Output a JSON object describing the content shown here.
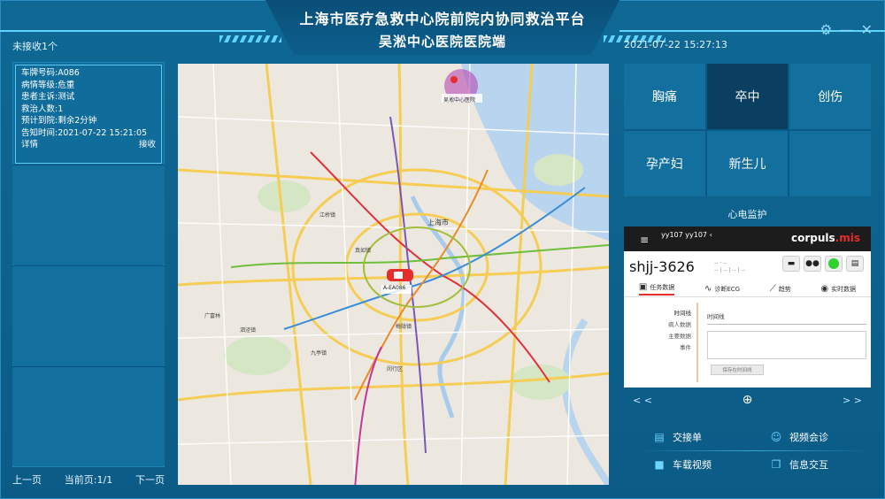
{
  "header": {
    "title_line1": "上海市医疗急救中心院前院内协同救治平台",
    "title_line2": "吴淞中心医院医院端",
    "unreceived": "未接收1个",
    "datetime": "2021-07-22 15:27:13"
  },
  "window_controls": {
    "settings_icon": "gear-icon",
    "minimize": "—",
    "close": "✕"
  },
  "patient_card": {
    "plate": "车牌号码:A086",
    "severity": "病情等级:危重",
    "complaint": "患者主诉:测试",
    "rescue_count": "救治人数:1",
    "eta": "预计到院:剩余2分钟",
    "notify_time": "告知时间:2021-07-22 15:21:05",
    "detail_label": "详情",
    "receive_label": "接收"
  },
  "pager": {
    "prev": "上一页",
    "current": "当前页:1/1",
    "next": "下一页"
  },
  "map": {
    "hospital_label": "吴淞中心医院",
    "vehicle_label": "A-EA086",
    "district_labels": [
      "上海市",
      "九亭镇",
      "泗泾镇",
      "广富林",
      "江桥镇",
      "真如镇",
      "梅陇镇",
      "闵行区"
    ]
  },
  "categories": [
    {
      "label": "胸痛",
      "active": false
    },
    {
      "label": "卒中",
      "active": true
    },
    {
      "label": "创伤",
      "active": false
    },
    {
      "label": "孕产妇",
      "active": false
    },
    {
      "label": "新生儿",
      "active": false
    }
  ],
  "ecg": {
    "section_title": "心电监护",
    "device_name": "yy107 yy107 ‹",
    "brand_main": "corpuls",
    "brand_suffix": ".mis",
    "device_id": "shjj-3626",
    "tabs": [
      "任务数据",
      "诊断ECG",
      "趋势",
      "实时数据"
    ],
    "side_items": [
      "时间线",
      "病人数据",
      "主要数据",
      "事件"
    ],
    "form_label": "时间线",
    "save_label": "保存在时间线",
    "nav_prev": "< <",
    "nav_next": "> >"
  },
  "actions": [
    {
      "label": "交接单",
      "icon": "document-icon"
    },
    {
      "label": "视频会诊",
      "icon": "group-icon"
    },
    {
      "label": "车载视频",
      "icon": "camera-icon"
    },
    {
      "label": "信息交互",
      "icon": "chat-icon"
    }
  ],
  "colors": {
    "background": "#0d5f8c",
    "accent": "#5fd3ff",
    "active_tile": "#0b3f62",
    "vehicle": "#e52d2d"
  }
}
